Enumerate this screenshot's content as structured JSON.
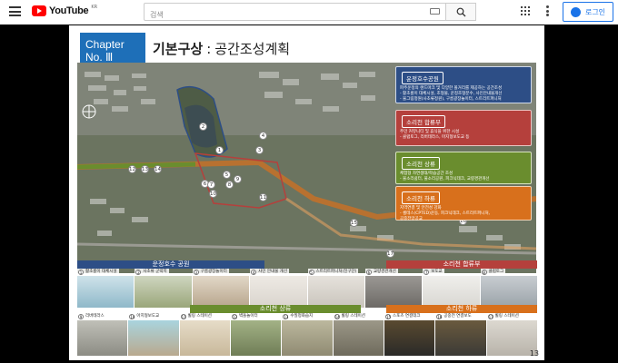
{
  "youtube": {
    "logo_text": "YouTube",
    "region": "KR",
    "search_placeholder": "검색",
    "login_label": "로그인"
  },
  "slide": {
    "chapter_word": "Chapter",
    "chapter_no": "No. Ⅲ",
    "title_main": "기본구상",
    "title_colon": ":",
    "title_sub": "공간조성계획",
    "page_number": "13"
  },
  "legend": [
    {
      "key": "blue",
      "title": "운정호수공원",
      "lines": [
        "파주운정의 랜드마크 및 다양한 볼거리를 제공하는 공간조성",
        "- 활초롱이 대체시설, 조형물, 운정조형분수, 사인안내물개선",
        "- 물그림정원(사초류정원), 구름광장놀이터, 스트리트퍼니처"
      ]
    },
    {
      "key": "red",
      "title": "소리천 합류부",
      "lines": [
        "주민 커뮤니티 및 휴식을 위한 시설",
        "- 클럽토그, 리버테라스, 마지형보도교 등"
      ]
    },
    {
      "key": "green",
      "title": "소리천 상류",
      "lines": [
        "체험형 자연생태/학습공간 조성",
        "- 물소리쉼터, 물소리공원, 피크닉데크, 교량경관개선"
      ]
    },
    {
      "key": "orange",
      "title": "소리천 하류",
      "lines": [
        "지역연결 및 안전성 강화",
        "- 셀테스(CPTED)운동, 피크닉데크, 스트리트퍼니처,",
        "  공중전망공교"
      ]
    }
  ],
  "bands": {
    "blue": "운정호수 공원",
    "red": "소리천 합류부",
    "green": "소리천 상류",
    "orange": "소리천 하류"
  },
  "row1": [
    {
      "n": "1",
      "label": "활초롱이 대체시설",
      "color": "#8fb8c9"
    },
    {
      "n": "2",
      "label": "사초류 군락지",
      "color": "#9aa67a"
    },
    {
      "n": "3",
      "label": "구름광장놀이터",
      "color": "#b7a58c"
    },
    {
      "n": "4",
      "label": "사인 안내물 개선",
      "color": "#d9d4cd"
    },
    {
      "n": "5",
      "label": "스트리트퍼니처(친구단)",
      "color": "#c9c4bc"
    },
    {
      "n": "6",
      "label": "교량경관개선",
      "color": "#6d6a66"
    },
    {
      "n": "7",
      "label": "보도교",
      "color": "#d8d6d1"
    },
    {
      "n": "8",
      "label": "클럽토그",
      "color": "#9aa2a8"
    }
  ],
  "row2": [
    {
      "n": "9",
      "label": "리버테라스",
      "color": "#8c8c84"
    },
    {
      "n": "10",
      "label": "아치형보도교",
      "color": "#b9a98e"
    },
    {
      "n": "11",
      "label": "휠링 스테이션",
      "color": "#c8b89a"
    },
    {
      "n": "12",
      "label": "벽돌놀이터",
      "color": "#6f7d56"
    },
    {
      "n": "13",
      "label": "수질정화습지",
      "color": "#8f8a72"
    },
    {
      "n": "14",
      "label": "휠링 스테이션",
      "color": "#6e6a5c"
    },
    {
      "n": "15",
      "label": "스포츠 연결데크",
      "color": "#2a2a28"
    },
    {
      "n": "16",
      "label": "공중전 연결보도",
      "color": "#3b3a36"
    },
    {
      "n": "17",
      "label": "휠링 스테이션",
      "color": "#b8b3aa"
    }
  ],
  "map_markers": [
    "1",
    "2",
    "3",
    "4",
    "5",
    "6",
    "7",
    "8",
    "9",
    "10",
    "11",
    "12",
    "13",
    "14",
    "15",
    "16",
    "17"
  ]
}
